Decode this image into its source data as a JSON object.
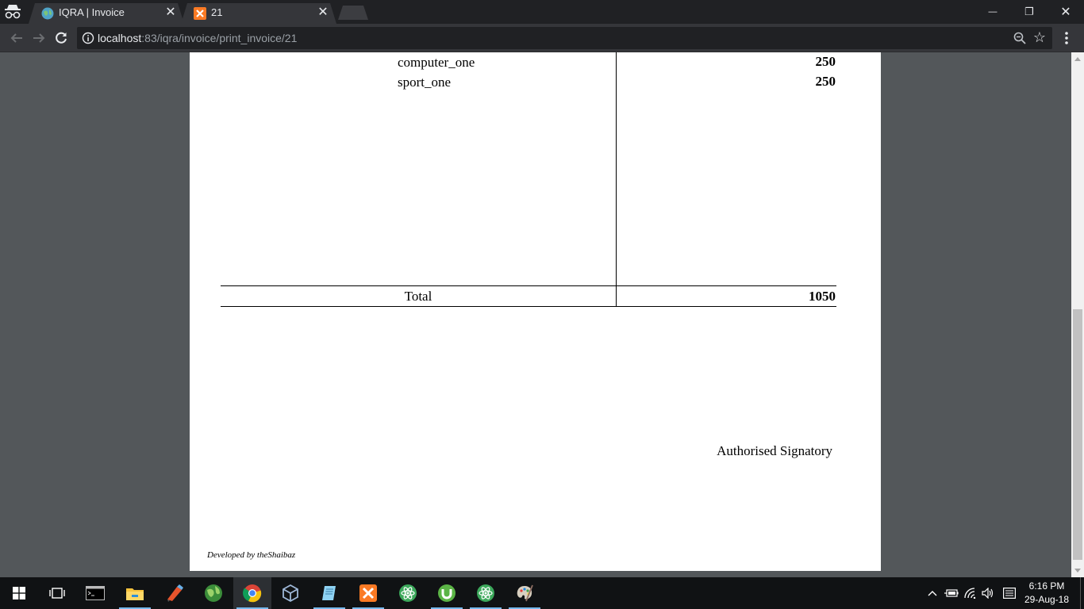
{
  "browser": {
    "tabs": [
      {
        "title": "IQRA | Invoice",
        "close": "✕"
      },
      {
        "title": "21",
        "close": "✕"
      }
    ],
    "window_controls": {
      "minimize": "—",
      "restore": "❐",
      "close": "✕"
    },
    "address_bar": {
      "host": "localhost",
      "path": ":83/iqra/invoice/print_invoice/21",
      "star": "☆"
    }
  },
  "invoice": {
    "items": [
      {
        "name": "computer_one",
        "amount": "250"
      },
      {
        "name": "sport_one",
        "amount": "250"
      }
    ],
    "total_label": "Total",
    "total_value": "1050",
    "signatory": "Authorised Signatory",
    "developer_credit": "Developed by theShaibaz"
  },
  "taskbar": {
    "apps": [
      "start-icon",
      "task-view-icon",
      "terminal-icon",
      "file-explorer-icon",
      "paint-icon",
      "globe-icon",
      "chrome-icon",
      "virtualbox-icon",
      "notepad-icon",
      "xampp-icon",
      "atom-icon",
      "utorrent-icon",
      "atom-icon",
      "paint-palette-icon"
    ],
    "clock": {
      "time": "6:16 PM",
      "date": "29-Aug-18"
    }
  },
  "colors": {
    "chrome_dark": "#202124",
    "toolbar": "#35363a",
    "page_gray": "#53575a",
    "taskbar": "#101214",
    "xampp_orange": "#fb7a24"
  }
}
